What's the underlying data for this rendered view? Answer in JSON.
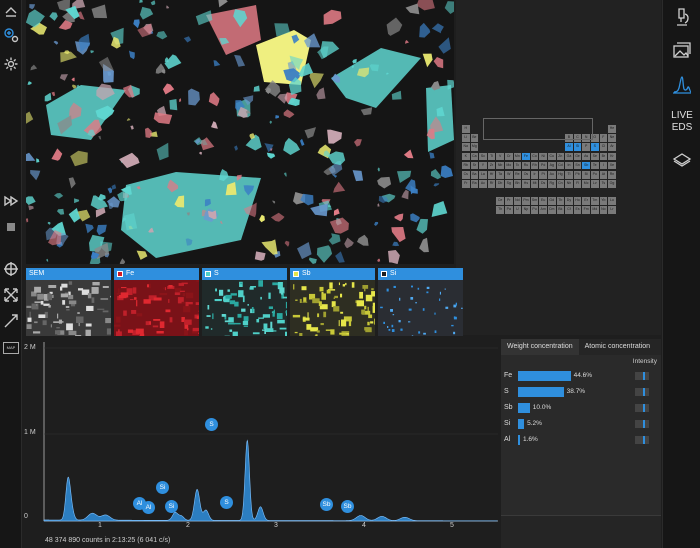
{
  "left_toolbar": {
    "icons": [
      "eject-icon",
      "zoom-in-icon",
      "settings-gear-icon",
      "fast-forward-icon",
      "stop-icon",
      "crosshair-icon",
      "expand-arrows-icon",
      "line-tool-icon",
      "map-icon"
    ],
    "map_label": "MAP"
  },
  "right_toolbar": {
    "icons": [
      "microscope-icon",
      "image-gallery-icon",
      "spectrum-icon",
      "layers-icon"
    ],
    "live_eds_line1": "LIVE",
    "live_eds_line2": "EDS"
  },
  "periodic_table": {
    "selected_elements": [
      "Fe",
      "S",
      "Sb",
      "Si",
      "Al"
    ]
  },
  "maps": [
    {
      "label": "SEM",
      "swatch": null
    },
    {
      "label": "Fe",
      "swatch": "#d11a24"
    },
    {
      "label": "S",
      "swatch": "#4fd0c8"
    },
    {
      "label": "Sb",
      "swatch": "#e6e64a"
    },
    {
      "label": "Si",
      "swatch": "#1e1e1e"
    }
  ],
  "spectrum": {
    "y_ticks": [
      "2 M",
      "1 M",
      "0"
    ],
    "x_ticks": [
      "1",
      "2",
      "3",
      "4",
      "5"
    ],
    "peak_labels": [
      "Al",
      "Al",
      "Si",
      "Si",
      "S",
      "S",
      "Sb",
      "Sb"
    ],
    "counts_info": "48 374 890 counts in 2:13:25 (6 041 c/s)",
    "colors": {
      "fill": "#2f8fde",
      "outline": "#7fc2ff"
    }
  },
  "concentration": {
    "tabs": [
      "Weight concentration",
      "Atomic concentration"
    ],
    "intensity_header": "Intensity",
    "rows": [
      {
        "element": "Fe",
        "value": "44.6%",
        "fraction": 0.446
      },
      {
        "element": "S",
        "value": "38.7%",
        "fraction": 0.387
      },
      {
        "element": "Sb",
        "value": "10.0%",
        "fraction": 0.1
      },
      {
        "element": "Si",
        "value": "5.2%",
        "fraction": 0.052
      },
      {
        "element": "Al",
        "value": "1.6%",
        "fraction": 0.016
      }
    ]
  }
}
